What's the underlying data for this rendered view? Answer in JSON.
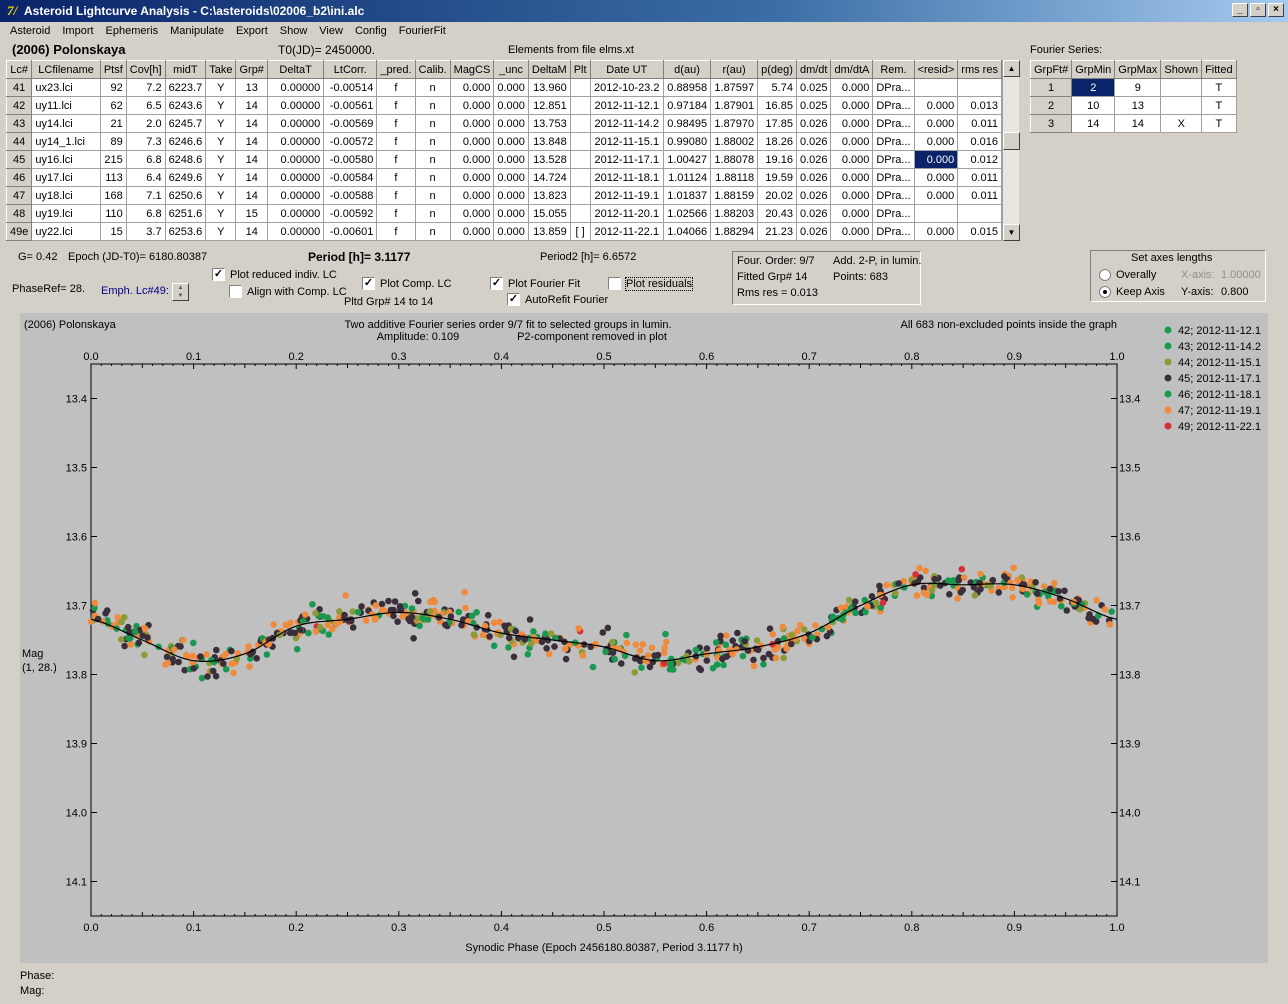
{
  "window": {
    "title": "Asteroid Lightcurve Analysis - C:\\asteroids\\02006_b2\\ini.alc"
  },
  "menu": [
    "Asteroid",
    "Import",
    "Ephemeris",
    "Manipulate",
    "Export",
    "Show",
    "View",
    "Config",
    "FourierFit"
  ],
  "header": {
    "asteroid": "(2006) Polonskaya",
    "t0": "T0(JD)= 2450000.",
    "elements": "Elements from file elms.xt",
    "fourier_series": "Fourier Series:"
  },
  "lc_table": {
    "columns": [
      "Lc#",
      "LCfilename",
      "Ptsf",
      "Cov[h]",
      "midT",
      "Take",
      "Grp#",
      "DeltaT",
      "LtCorr.",
      "_pred.",
      "Calib.",
      "MagCS",
      "_unc",
      "DeltaM",
      "Plt",
      "Date UT",
      "d(au)",
      "r(au)",
      "p(deg)",
      "dm/dt",
      "dm/dtA",
      "Rem.",
      "<resid>",
      "rms res"
    ],
    "rows": [
      [
        "41",
        "ux23.lci",
        "92",
        "7.2",
        "6223.7",
        "Y",
        "13",
        "0.00000",
        "-0.00514",
        "f",
        "n",
        "0.000",
        "0.000",
        "13.960",
        "",
        "2012-10-23.2",
        "0.88958",
        "1.87597",
        "5.74",
        "0.025",
        "0.000",
        "DPra...",
        "",
        ""
      ],
      [
        "42",
        "uy11.lci",
        "62",
        "6.5",
        "6243.6",
        "Y",
        "14",
        "0.00000",
        "-0.00561",
        "f",
        "n",
        "0.000",
        "0.000",
        "12.851",
        "",
        "2012-11-12.1",
        "0.97184",
        "1.87901",
        "16.85",
        "0.025",
        "0.000",
        "DPra...",
        "0.000",
        "0.013"
      ],
      [
        "43",
        "uy14.lci",
        "21",
        "2.0",
        "6245.7",
        "Y",
        "14",
        "0.00000",
        "-0.00569",
        "f",
        "n",
        "0.000",
        "0.000",
        "13.753",
        "",
        "2012-11-14.2",
        "0.98495",
        "1.87970",
        "17.85",
        "0.026",
        "0.000",
        "DPra...",
        "0.000",
        "0.011"
      ],
      [
        "44",
        "uy14_1.lci",
        "89",
        "7.3",
        "6246.6",
        "Y",
        "14",
        "0.00000",
        "-0.00572",
        "f",
        "n",
        "0.000",
        "0.000",
        "13.848",
        "",
        "2012-11-15.1",
        "0.99080",
        "1.88002",
        "18.26",
        "0.026",
        "0.000",
        "DPra...",
        "0.000",
        "0.016"
      ],
      [
        "45",
        "uy16.lci",
        "215",
        "6.8",
        "6248.6",
        "Y",
        "14",
        "0.00000",
        "-0.00580",
        "f",
        "n",
        "0.000",
        "0.000",
        "13.528",
        "",
        "2012-11-17.1",
        "1.00427",
        "1.88078",
        "19.16",
        "0.026",
        "0.000",
        "DPra...",
        "0.000",
        "0.012"
      ],
      [
        "46",
        "uy17.lci",
        "113",
        "6.4",
        "6249.6",
        "Y",
        "14",
        "0.00000",
        "-0.00584",
        "f",
        "n",
        "0.000",
        "0.000",
        "14.724",
        "",
        "2012-11-18.1",
        "1.01124",
        "1.88118",
        "19.59",
        "0.026",
        "0.000",
        "DPra...",
        "0.000",
        "0.011"
      ],
      [
        "47",
        "uy18.lci",
        "168",
        "7.1",
        "6250.6",
        "Y",
        "14",
        "0.00000",
        "-0.00588",
        "f",
        "n",
        "0.000",
        "0.000",
        "13.823",
        "",
        "2012-11-19.1",
        "1.01837",
        "1.88159",
        "20.02",
        "0.026",
        "0.000",
        "DPra...",
        "0.000",
        "0.011"
      ],
      [
        "48",
        "uy19.lci",
        "110",
        "6.8",
        "6251.6",
        "Y",
        "15",
        "0.00000",
        "-0.00592",
        "f",
        "n",
        "0.000",
        "0.000",
        "15.055",
        "",
        "2012-11-20.1",
        "1.02566",
        "1.88203",
        "20.43",
        "0.026",
        "0.000",
        "DPra...",
        "",
        ""
      ],
      [
        "49e",
        "uy22.lci",
        "15",
        "3.7",
        "6253.6",
        "Y",
        "14",
        "0.00000",
        "-0.00601",
        "f",
        "n",
        "0.000",
        "0.000",
        "13.859",
        "[ ]",
        "2012-11-22.1",
        "1.04066",
        "1.88294",
        "21.23",
        "0.026",
        "0.000",
        "DPra...",
        "0.000",
        "0.015"
      ]
    ]
  },
  "fourier_table": {
    "columns": [
      "GrpFt#",
      "GrpMin",
      "GrpMax",
      "Shown",
      "Fitted"
    ],
    "rows": [
      [
        "1",
        "2",
        "9",
        "",
        "T"
      ],
      [
        "2",
        "10",
        "13",
        "",
        "T"
      ],
      [
        "3",
        "14",
        "14",
        "X",
        "T"
      ]
    ]
  },
  "info": {
    "g": "G= 0.42",
    "epoch": "Epoch (JD-T0)= 6180.80387",
    "period": "Period [h]= 3.1177",
    "period2": "Period2 [h]= 6.6572",
    "phaseref": "PhaseRef= 28.",
    "emph": "Emph. Lc#49:",
    "pltd": "Pltd Grp#  14 to   14"
  },
  "checks": {
    "reduced": "Plot reduced indiv. LC",
    "align": "Align with Comp. LC",
    "comp": "Plot Comp. LC",
    "fourier": "Plot Fourier Fit",
    "autorefit": "AutoRefit Fourier",
    "residuals": "Plot residuals"
  },
  "fit_panel": {
    "order": "Four. Order:  9/7",
    "add": "Add. 2-P, in lumin.",
    "grp": "Fitted Grp# 14",
    "points": "Points: 683",
    "rms": "Rms res     = 0.013"
  },
  "axes_panel": {
    "title": "Set axes lengths",
    "overally": "Overally",
    "keep": "Keep Axis",
    "xaxis_label": "X-axis:",
    "xaxis_val": "1.00000",
    "yaxis_label": "Y-axis:",
    "yaxis_val": "0.800"
  },
  "plot": {
    "topleft": "(2006) Polonskaya",
    "title1": "Two additive Fourier series order 9/7 fit to selected groups in lumin.",
    "title2": "Amplitude: 0.109",
    "title3": "P2-component removed in plot",
    "topright": "All 683 non-excluded points inside the graph",
    "ylabel1": "Mag",
    "ylabel2": "(1, 28.)",
    "xlabel": "Synodic Phase (Epoch 2456180.80387, Period 3.1177 h)",
    "legend": [
      {
        "label": "42; 2012-11-12.1",
        "color": "#1a9850"
      },
      {
        "label": "43; 2012-11-14.2",
        "color": "#1a9850"
      },
      {
        "label": "44; 2012-11-15.1",
        "color": "#8c9a3a"
      },
      {
        "label": "45; 2012-11-17.1",
        "color": "#3a2e3a"
      },
      {
        "label": "46; 2012-11-18.1",
        "color": "#1a9850"
      },
      {
        "label": "47; 2012-11-19.1",
        "color": "#f08a3c"
      },
      {
        "label": "49; 2012-11-22.1",
        "color": "#d7303a"
      }
    ]
  },
  "chart_data": {
    "type": "scatter",
    "xlabel": "Synodic Phase (Epoch 2456180.80387, Period 3.1177 h)",
    "ylabel": "Mag",
    "xlim": [
      0,
      1
    ],
    "ylim": [
      14.15,
      13.35
    ],
    "y_inverted": true,
    "x_ticks": [
      "0.0",
      "0.1",
      "0.2",
      "0.3",
      "0.4",
      "0.5",
      "0.6",
      "0.7",
      "0.8",
      "0.9",
      "1.0"
    ],
    "y_ticks": [
      "13.4",
      "13.5",
      "13.6",
      "13.7",
      "13.8",
      "13.9",
      "14.0",
      "14.1"
    ],
    "fit_curve": {
      "x": [
        0.0,
        0.05,
        0.1,
        0.15,
        0.2,
        0.25,
        0.3,
        0.35,
        0.4,
        0.45,
        0.5,
        0.55,
        0.6,
        0.65,
        0.7,
        0.75,
        0.8,
        0.85,
        0.9,
        0.95,
        1.0
      ],
      "y": [
        13.72,
        13.75,
        13.78,
        13.77,
        13.73,
        13.72,
        13.71,
        13.72,
        13.74,
        13.75,
        13.76,
        13.78,
        13.77,
        13.76,
        13.74,
        13.7,
        13.67,
        13.67,
        13.67,
        13.69,
        13.72
      ]
    },
    "scatter_sd": 0.011
  },
  "status": {
    "phase": "Phase:",
    "mag": "Mag:"
  }
}
